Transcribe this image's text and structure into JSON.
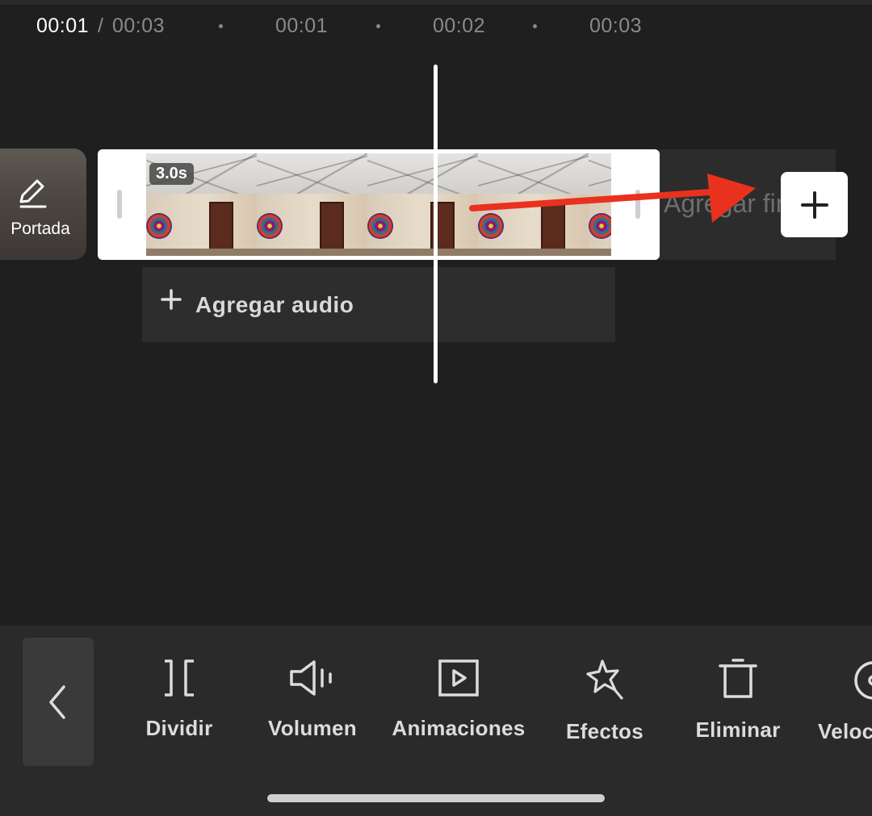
{
  "ruler": {
    "current_time": "00:01",
    "separator": "/",
    "total_time": "00:03",
    "ticks": [
      "00:01",
      "00:02",
      "00:03"
    ]
  },
  "cover": {
    "label": "Portada",
    "icon": "pencil-icon"
  },
  "clip": {
    "duration": "3.0s"
  },
  "end_area": {
    "label": "Agregar final",
    "add_icon": "plus-icon"
  },
  "audio": {
    "label": "Agregar audio",
    "icon": "plus-icon"
  },
  "overlay": {
    "arrow_color": "#e8321e"
  },
  "toolbar": {
    "back_icon": "chevron-left-icon",
    "tools": [
      {
        "label": "Dividir",
        "icon": "split-icon"
      },
      {
        "label": "Volumen",
        "icon": "volume-icon"
      },
      {
        "label": "Animaciones",
        "icon": "animation-icon"
      },
      {
        "label": "Efectos",
        "icon": "effects-icon"
      },
      {
        "label": "Eliminar",
        "icon": "trash-icon"
      },
      {
        "label": "Veloc",
        "icon": "speed-icon"
      }
    ]
  },
  "colors": {
    "background": "#1f1f1f",
    "toolbar": "#2a2a2a",
    "accent_arrow": "#e8321e"
  }
}
